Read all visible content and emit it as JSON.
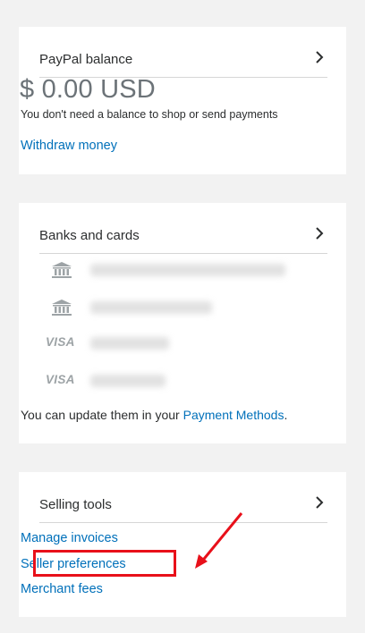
{
  "balance_card": {
    "title": "PayPal balance",
    "amount": "$ 0.00 USD",
    "note": "You don't need a balance to shop or send payments",
    "withdraw_label": "Withdraw money"
  },
  "banks_card": {
    "title": "Banks and cards",
    "methods": [
      {
        "kind": "bank",
        "icon": "bank-icon"
      },
      {
        "kind": "bank",
        "icon": "bank-icon"
      },
      {
        "kind": "card",
        "icon": "visa-logo",
        "brand": "VISA"
      },
      {
        "kind": "card",
        "icon": "visa-logo",
        "brand": "VISA"
      }
    ],
    "note_prefix": "You can update them in your ",
    "note_link": "Payment Methods",
    "note_suffix": "."
  },
  "selling_card": {
    "title": "Selling tools",
    "links": [
      {
        "label": "Manage invoices"
      },
      {
        "label": "Seller preferences"
      },
      {
        "label": "Merchant fees"
      }
    ]
  },
  "colors": {
    "link": "#0070ba",
    "highlight": "#e8101a",
    "background": "#f2f2f2"
  }
}
